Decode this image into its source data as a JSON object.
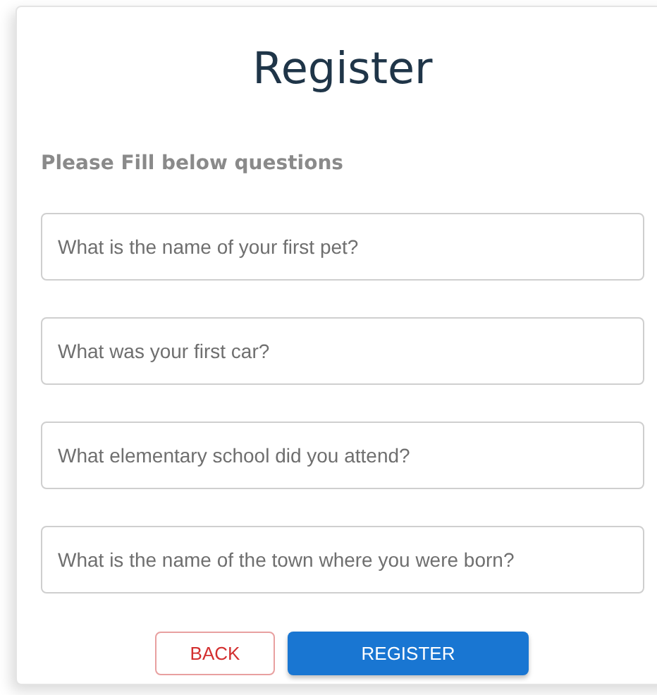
{
  "title": "Register",
  "subtitle": "Please Fill below questions",
  "fields": [
    {
      "placeholder": "What is the name of your first pet?"
    },
    {
      "placeholder": "What was your first car?"
    },
    {
      "placeholder": "What elementary school did you attend?"
    },
    {
      "placeholder": "What is the name of the town where you were born?"
    }
  ],
  "buttons": [
    {
      "label": "BACK",
      "kind": "outlined"
    },
    {
      "label": "REGISTER",
      "kind": "primary"
    }
  ]
}
